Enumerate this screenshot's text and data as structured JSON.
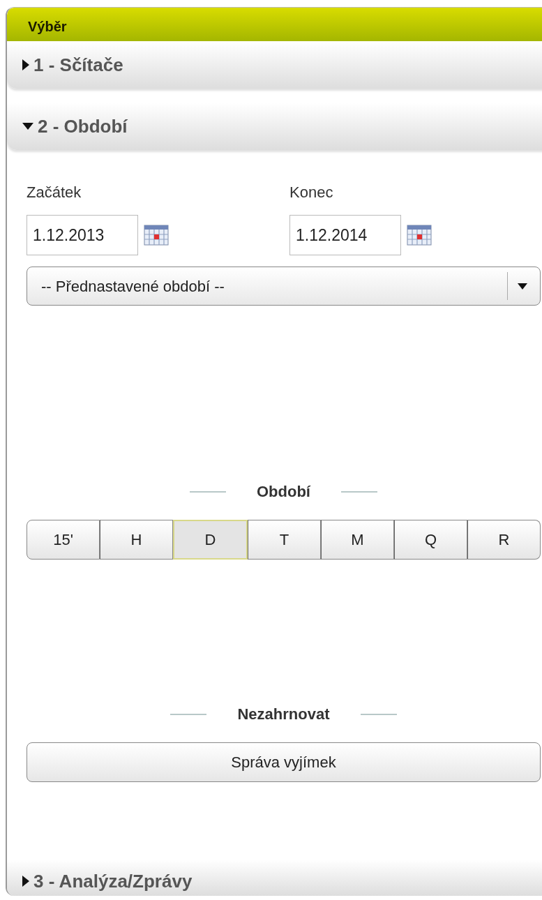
{
  "panel": {
    "title": "Výběr"
  },
  "sections": [
    {
      "label": "1 - Sčítače",
      "expanded": false
    },
    {
      "label": "2 - Období",
      "expanded": true
    },
    {
      "label": "3 - Analýza/Zprávy",
      "expanded": false
    }
  ],
  "period": {
    "start_label": "Začátek",
    "start_value": "1.12.2013",
    "end_label": "Konec",
    "end_value": "1.12.2014",
    "preset": "-- Přednastavené období --",
    "granularity_heading": "Období",
    "granularity": [
      {
        "label": "15'",
        "selected": false
      },
      {
        "label": "H",
        "selected": false
      },
      {
        "label": "D",
        "selected": true
      },
      {
        "label": "T",
        "selected": false
      },
      {
        "label": "M",
        "selected": false
      },
      {
        "label": "Q",
        "selected": false
      },
      {
        "label": "R",
        "selected": false
      }
    ],
    "exclude_heading": "Nezahrnovat",
    "exclude_button": "Správa vyjímek"
  }
}
